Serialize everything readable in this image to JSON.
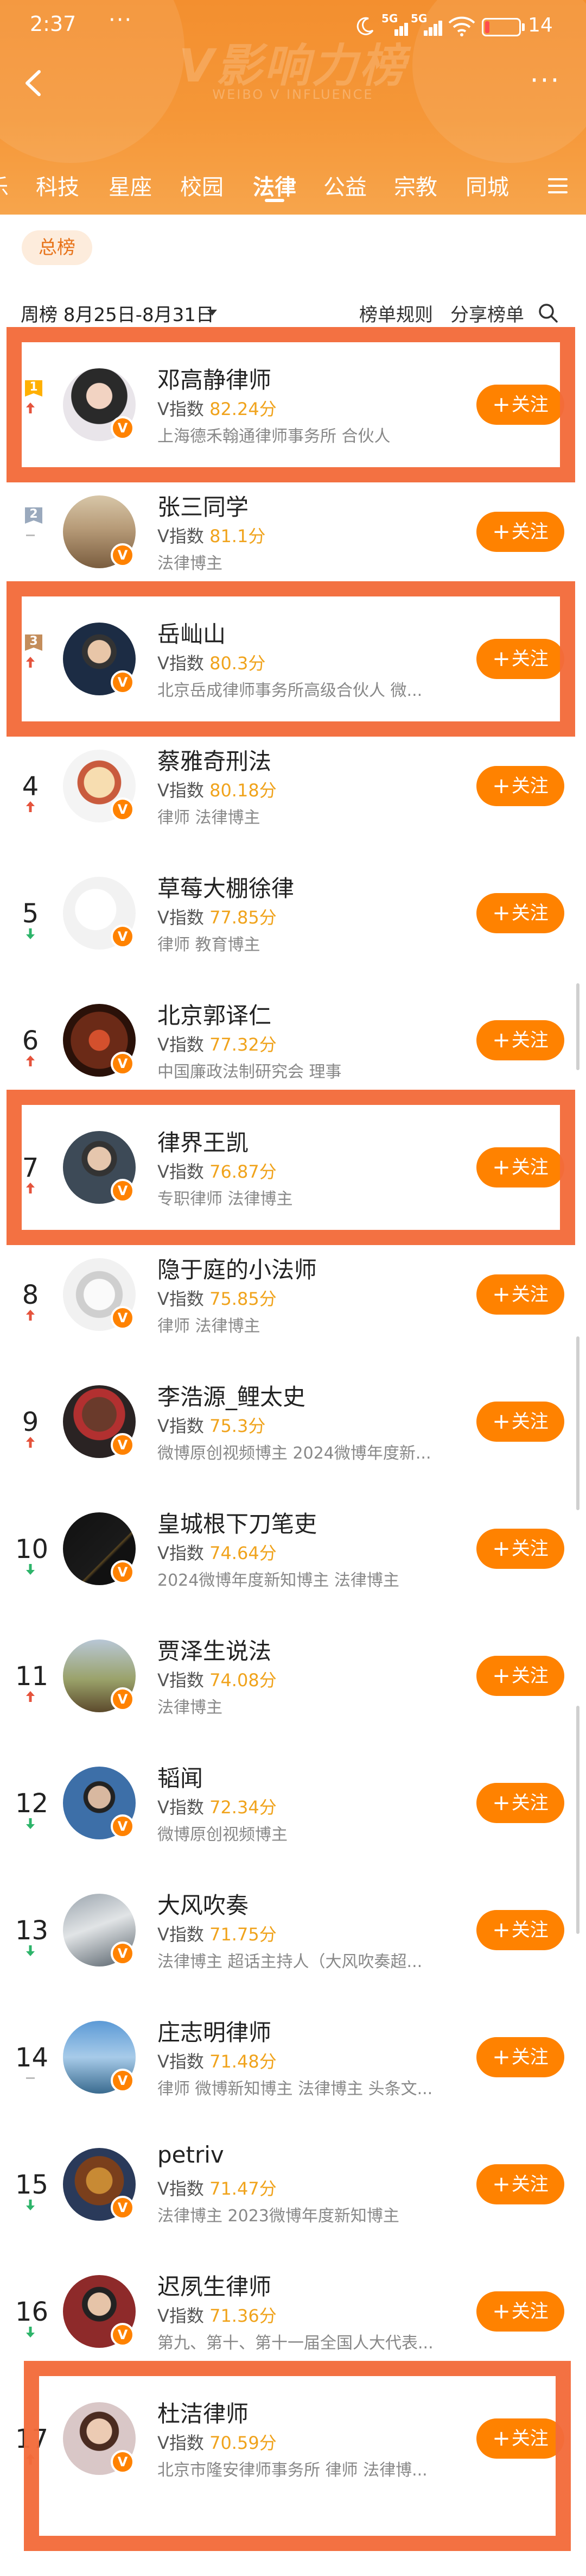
{
  "status_bar": {
    "time": "2:37",
    "dots": "···",
    "net_label": "5G",
    "battery_percent": "14",
    "battery_level": 0.14
  },
  "header": {
    "brand_title": "V影响力榜",
    "brand_subtitle": "WEIBO V INFLUENCE",
    "more_label": "···"
  },
  "category_tabs": [
    "娱乐",
    "科技",
    "星座",
    "校园",
    "法律",
    "公益",
    "宗教",
    "同城"
  ],
  "active_tab": "法律",
  "overall_chip": "总榜",
  "filter_bar": {
    "period": "周榜 8月25日-8月31日",
    "rules": "榜单规则",
    "share": "分享榜单"
  },
  "follow_label": "关注",
  "colors": {
    "accent": "#ff8200",
    "header": "#f59738",
    "score": "#f0a31c",
    "highlight": "#f26b3a",
    "trend_up": "#e5533c",
    "trend_down": "#2db46a"
  },
  "ranking": [
    {
      "rank": "1",
      "trend": "up",
      "name": "邓高静律师",
      "v_label": "V指数",
      "score": "82.24分",
      "desc": "上海德禾翰通律师事务所 合伙人",
      "highlighted": true
    },
    {
      "rank": "2",
      "trend": "flat",
      "name": "张三同学",
      "v_label": "V指数",
      "score": "81.1分",
      "desc": "法律博主",
      "highlighted": false
    },
    {
      "rank": "3",
      "trend": "up",
      "name": "岳屾山",
      "v_label": "V指数",
      "score": "80.3分",
      "desc": "北京岳成律师事务所高级合伙人 微...",
      "highlighted": true
    },
    {
      "rank": "4",
      "trend": "up",
      "name": "蔡雅奇刑法",
      "v_label": "V指数",
      "score": "80.18分",
      "desc": "律师 法律博主",
      "highlighted": false
    },
    {
      "rank": "5",
      "trend": "down",
      "name": "草莓大棚徐律",
      "v_label": "V指数",
      "score": "77.85分",
      "desc": "律师 教育博主",
      "highlighted": false
    },
    {
      "rank": "6",
      "trend": "up",
      "name": "北京郭译仁",
      "v_label": "V指数",
      "score": "77.32分",
      "desc": "中国廉政法制研究会 理事",
      "highlighted": false
    },
    {
      "rank": "7",
      "trend": "up",
      "name": "律界王凯",
      "v_label": "V指数",
      "score": "76.87分",
      "desc": "专职律师 法律博主",
      "highlighted": true
    },
    {
      "rank": "8",
      "trend": "up",
      "name": "隐于庭的小法师",
      "v_label": "V指数",
      "score": "75.85分",
      "desc": "律师 法律博主",
      "highlighted": false
    },
    {
      "rank": "9",
      "trend": "up",
      "name": "李浩源_鲤太史",
      "v_label": "V指数",
      "score": "75.3分",
      "desc": "微博原创视频博主 2024微博年度新...",
      "highlighted": false
    },
    {
      "rank": "10",
      "trend": "down",
      "name": "皇城根下刀笔吏",
      "v_label": "V指数",
      "score": "74.64分",
      "desc": "2024微博年度新知博主 法律博主",
      "highlighted": false
    },
    {
      "rank": "11",
      "trend": "up",
      "name": "贾泽生说法",
      "v_label": "V指数",
      "score": "74.08分",
      "desc": "法律博主",
      "highlighted": false
    },
    {
      "rank": "12",
      "trend": "down",
      "name": "韬闻",
      "v_label": "V指数",
      "score": "72.34分",
      "desc": "微博原创视频博主",
      "highlighted": false
    },
    {
      "rank": "13",
      "trend": "down",
      "name": "大风吹奏",
      "v_label": "V指数",
      "score": "71.75分",
      "desc": "法律博主 超话主持人（大风吹奏超...",
      "highlighted": false
    },
    {
      "rank": "14",
      "trend": "flat",
      "name": "庄志明律师",
      "v_label": "V指数",
      "score": "71.48分",
      "desc": "律师 微博新知博主 法律博主 头条文...",
      "highlighted": false
    },
    {
      "rank": "15",
      "trend": "down",
      "name": "petriv",
      "v_label": "V指数",
      "score": "71.47分",
      "desc": "法律博主 2023微博年度新知博主",
      "highlighted": false
    },
    {
      "rank": "16",
      "trend": "down",
      "name": "迟夙生律师",
      "v_label": "V指数",
      "score": "71.36分",
      "desc": "第九、第十、第十一届全国人大代表...",
      "highlighted": false
    },
    {
      "rank": "17",
      "trend": "up",
      "name": "杜洁律师",
      "v_label": "V指数",
      "score": "70.59分",
      "desc": "北京市隆安律师事务所 律师 法律博...",
      "highlighted": true
    }
  ]
}
